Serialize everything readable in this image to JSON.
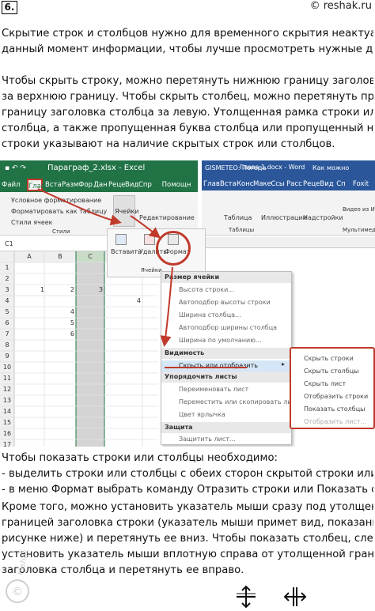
{
  "header": {
    "number": "6.",
    "brand": "© reshak.ru"
  },
  "paragraphs": {
    "intro": [
      "Скрытие строк и столбцов нужно для временного скрытия неактуальной на",
      "данный момент информации, чтобы лучше просмотреть нужные данные."
    ],
    "hide": [
      "Чтобы скрыть строку, можно перетянуть нижнюю границу заголовка строки",
      "за верхнюю границу. Чтобы скрыть столбец, можно перетянуть правую",
      "границу заголовка столбца за левую. Утолщенная рамка строки или",
      "столбца, а также пропущенная буква столбца или пропущенный номер",
      "строки указывают на наличие скрытых строк или столбцов."
    ],
    "show": [
      "Чтобы показать строки или столбцы необходимо:",
      "- выделить строки или столбцы с обеих сторон скрытой строки или столбца;",
      "- в меню Формат выбрать команду Отразить строки или Показать столбцы.",
      "Кроме того, можно установить указатель мыши сразу под утолщенной",
      "границей заголовка строки (указатель мыши примет вид, показанный на",
      "рисунке ниже) и перетянуть ее вниз. Чтобы показать столбец, следует",
      "установить указатель мыши вплотную справа от утолщенной границы",
      "заголовка столбца и перетянуть ее вправо."
    ]
  },
  "excel": {
    "title": "Параграф_2.xlsx - Excel",
    "tabs": [
      "Файл",
      "Глав",
      "Вста",
      "Разм",
      "Фор",
      "Дан",
      "Реце",
      "Вид",
      "Спр",
      "Помощн"
    ],
    "ribbon_items": [
      "Условное форматирование",
      "Форматировать как таблицу",
      "Стили ячеек",
      "Стили",
      "Ячейки",
      "Редактирование"
    ],
    "name_box": "C1",
    "columns": [
      "A",
      "B",
      "C",
      "D"
    ],
    "rows": [
      "1",
      "2",
      "3",
      "4",
      "5",
      "6",
      "7",
      "8",
      "9",
      "10",
      "11",
      "12",
      "13",
      "14",
      "15",
      "16",
      "17"
    ],
    "values": {
      "a3": "1",
      "b3": "2",
      "c3": "3",
      "b5": "4",
      "b6": "5",
      "b7": "6",
      "d4": "4"
    }
  },
  "cells_popup": {
    "insert": "Вставить",
    "delete": "Удалить",
    "format": "Формат",
    "group": "Ячейки"
  },
  "word": {
    "doc_tab": "Глава 1.docx - Word",
    "other_tab": "GISMETEO: Погода",
    "more": "Как можно",
    "tabs": [
      "Глав",
      "Вста",
      "Конс",
      "Маке",
      "Ссы",
      "Расс",
      "Реце",
      "Вид",
      "Сп",
      "Foxit"
    ],
    "ribbon_items": [
      "Таблица",
      "Иллюстрации",
      "Надстройки",
      "Видео из Интернета",
      "Таблицы",
      "Мультимеда"
    ]
  },
  "format_menu": {
    "cell_size": "Размер ячейки",
    "row_height": "Высота строки...",
    "auto_row": "Автоподбор высоты строки",
    "col_width": "Ширина столбца...",
    "auto_col": "Автоподбор ширины столбца",
    "default_width": "Ширина по умолчанию...",
    "visibility": "Видимость",
    "hide_show": "Скрыть или отобразить",
    "arrange": "Упорядочить листы",
    "rename": "Переименовать лист",
    "move_copy": "Переместить или скопировать лист...",
    "tab_color": "Цвет ярлычка",
    "protection": "Защита",
    "protect_sheet": "Защитить лист..."
  },
  "submenu": {
    "items": [
      "Скрыть строки",
      "Скрыть столбцы",
      "Скрыть лист",
      "Отобразить строки",
      "Показать столбцы",
      "Отобразить лист..."
    ]
  },
  "cursor_icons": [
    "row-resize-cursor",
    "col-resize-cursor"
  ],
  "colors": {
    "excel_green": "#217346",
    "word_blue": "#2b579a",
    "highlight_red": "#c0392b"
  }
}
